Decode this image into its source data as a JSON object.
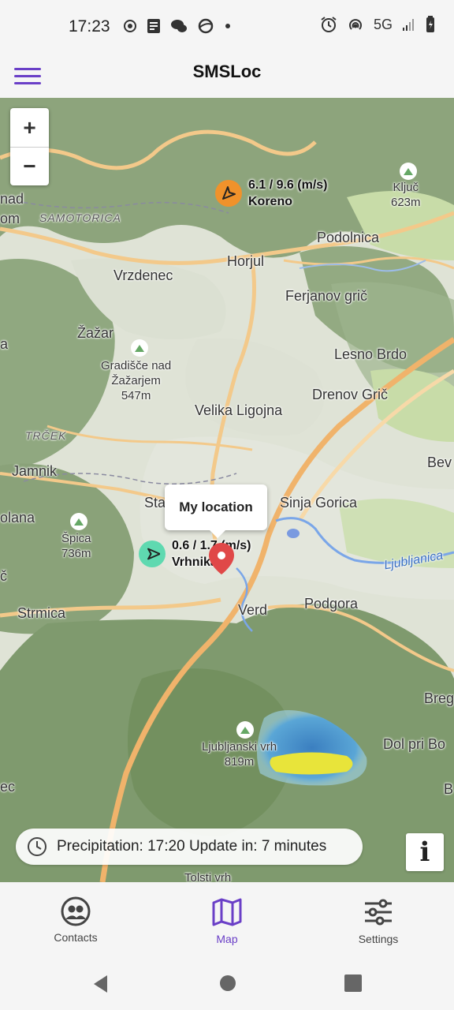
{
  "status_bar": {
    "time": "17:23",
    "network": "5G",
    "left_icons": [
      "record-icon",
      "notes-icon",
      "chat-icon",
      "globe-icon",
      "dot-icon"
    ],
    "right_icons": [
      "alarm-icon",
      "hotspot-icon",
      "signal-icon",
      "battery-icon"
    ]
  },
  "app_bar": {
    "title": "SMSLoc",
    "menu_icon": "hamburger-menu-icon"
  },
  "map": {
    "zoom_in": "+",
    "zoom_out": "−",
    "places": {
      "samotorica": "SAMOTORICA",
      "nad": "nad",
      "om": "om",
      "podolnica": "Podolnica",
      "horjul": "Horjul",
      "vrzdenec": "Vrzdenec",
      "ferjanov_gric": "Ferjanov grič",
      "zazar": "Žažar",
      "lesno_brdo": "Lesno Brdo",
      "gradisce_line1": "Gradišče nad",
      "gradisce_line2": "Žažarjem",
      "gradisce_elev": "547m",
      "drenov_gric": "Drenov Grič",
      "velika_ligojna": "Velika Ligojna",
      "trcek": "TRČEK",
      "jamnik": "Jamnik",
      "bev": "Bev",
      "sta": "Sta",
      "sinja_gorica": "Sinja Gorica",
      "olana": "olana",
      "spica": "Špica",
      "spica_elev": "736m",
      "c_left": "č",
      "ljubljanica": "Ljubljanica",
      "strmica": "Strmica",
      "verd": "Verd",
      "podgora": "Podgora",
      "breg": "Breg",
      "ljubljanski_vrh": "Ljubljanski vrh",
      "ljubljanski_elev": "819m",
      "dol_pri_bo": "Dol pri Bo",
      "ec": "ec",
      "b_right": "B",
      "kljuc": "Ključ",
      "kljuc_elev": "623m",
      "tolsti_vrh": "Tolsti vrh",
      "a_left": "a"
    },
    "stations": [
      {
        "name": "Koreno",
        "wind": "6.1 / 9.6 (m/s)",
        "color": "#f0922b"
      },
      {
        "name": "Vrhnika",
        "wind": "0.6 / 1.7 (m/s)",
        "color": "#5fd9b0"
      }
    ],
    "my_location_popup": "My location",
    "pin_color": "#e04848",
    "precipitation": "Precipitation: 17:20 Update in: 7 minutes",
    "info_button": "i"
  },
  "bottom_nav": {
    "items": [
      {
        "label": "Contacts",
        "icon": "contacts-icon",
        "active": false
      },
      {
        "label": "Map",
        "icon": "map-icon",
        "active": true
      },
      {
        "label": "Settings",
        "icon": "settings-sliders-icon",
        "active": false
      }
    ],
    "accent": "#6a3fc7"
  },
  "system_nav": [
    "back-icon",
    "home-icon",
    "recents-icon"
  ]
}
